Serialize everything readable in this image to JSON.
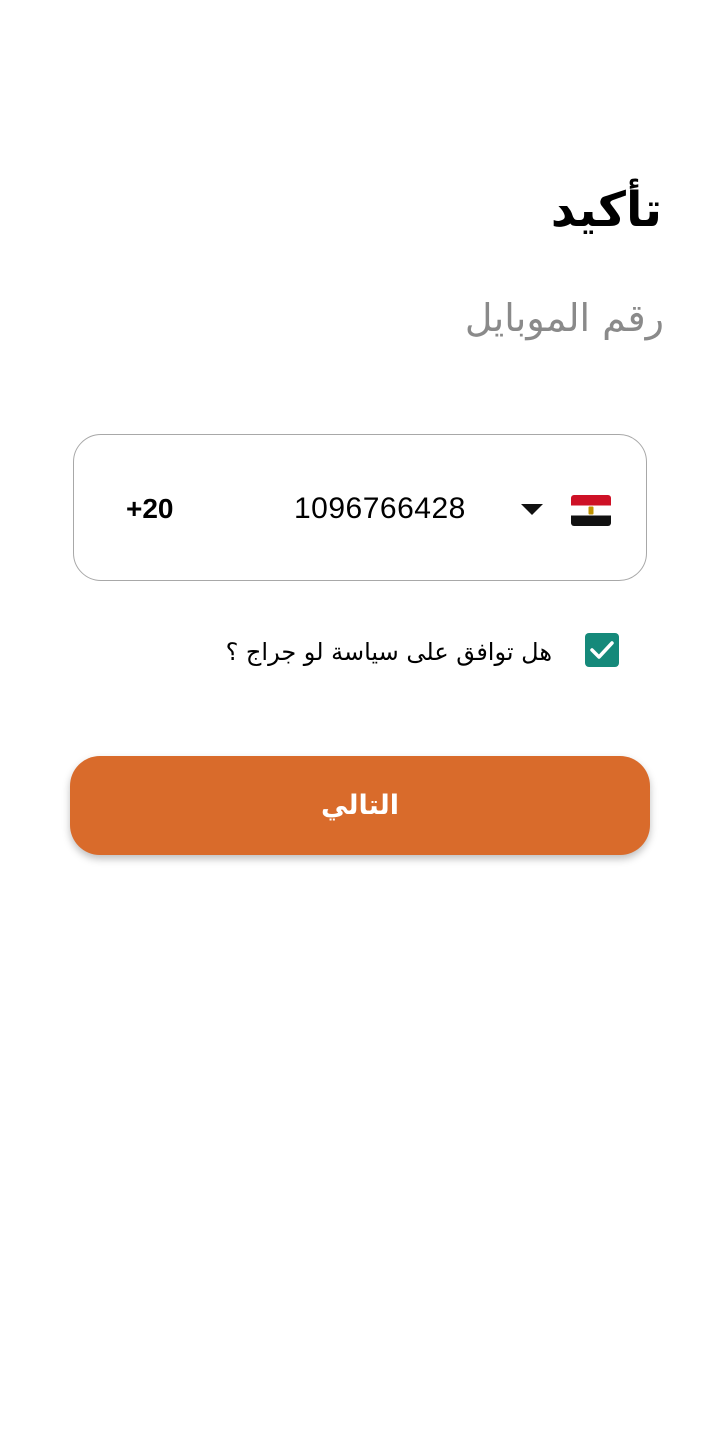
{
  "header": {
    "title": "تأكيد",
    "subtitle": "رقم الموبايل"
  },
  "phone": {
    "dial_code": "+20",
    "number": "1096766428",
    "country_flag": "egypt-flag",
    "dropdown_icon": "caret-down-icon"
  },
  "agreement": {
    "checked": true,
    "label": "هل توافق على سياسة لو جراج ؟"
  },
  "actions": {
    "next_label": "التالي"
  },
  "colors": {
    "accent": "#d96b2b",
    "checkbox": "#15897a",
    "subtitle": "#8a8a8a"
  }
}
